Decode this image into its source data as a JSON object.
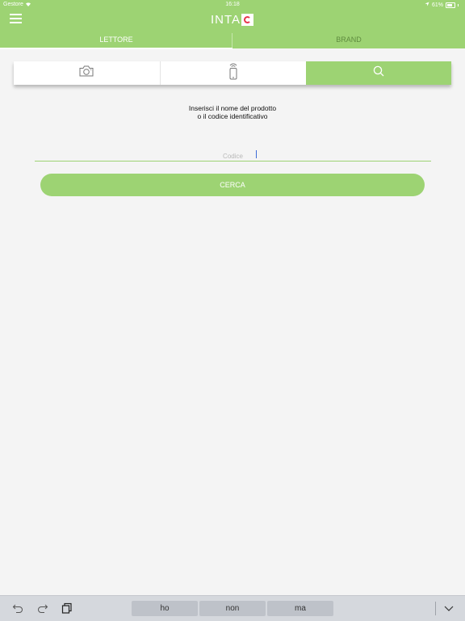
{
  "status_bar": {
    "carrier": "Gestore",
    "time": "16:18",
    "battery": "61%"
  },
  "header": {
    "logo_text": "INTA",
    "menu_icon": "hamburger-icon"
  },
  "tabs": [
    {
      "label": "LETTORE",
      "active": true
    },
    {
      "label": "BRAND",
      "active": false
    }
  ],
  "modes": [
    {
      "icon": "camera-icon",
      "active": false
    },
    {
      "icon": "nfc-phone-icon",
      "active": false
    },
    {
      "icon": "search-icon",
      "active": true
    }
  ],
  "prompt": {
    "line1": "Inserisci il nome del prodotto",
    "line2": "o il codice identificativo"
  },
  "search": {
    "placeholder": "Codice",
    "value": "",
    "button_label": "CERCA"
  },
  "keyboard": {
    "suggestions": [
      "ho",
      "non",
      "ma"
    ],
    "icons": [
      "undo-icon",
      "redo-icon",
      "paste-icon",
      "dismiss-keyboard-icon"
    ]
  },
  "colors": {
    "accent": "#9dd373",
    "brand_red": "#e8364b",
    "background": "#f4f4f4"
  }
}
